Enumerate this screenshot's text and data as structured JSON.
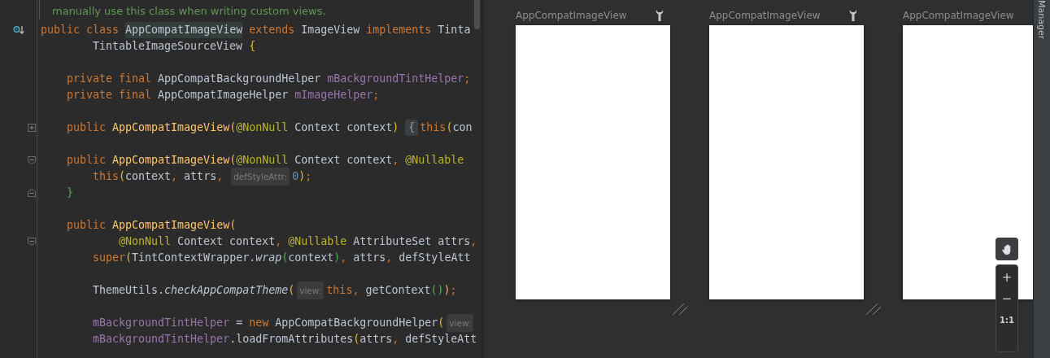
{
  "editor": {
    "doc_comment": "manually use this class when writing custom views.",
    "lines": [
      {
        "kind": "code",
        "marker": {
          "kind": "implemented"
        },
        "words": [
          [
            {
              "kind": "kw",
              "text": "public"
            }
          ],
          [
            {
              "kind": "kw",
              "text": "class"
            }
          ],
          [
            {
              "kind": "hl",
              "text": "AppCompatImageView"
            }
          ],
          [
            {
              "kind": "kw",
              "text": "extends"
            }
          ],
          [
            {
              "kind": "type",
              "text": "ImageView"
            }
          ],
          [
            {
              "kind": "kw",
              "text": "implements"
            }
          ],
          [
            {
              "kind": "type",
              "text": "Tinta"
            }
          ]
        ]
      },
      {
        "kind": "code",
        "indent": {
          "kind": "double"
        },
        "words": [
          [
            {
              "kind": "type",
              "text": "TintableImageSourceView"
            }
          ],
          [
            {
              "kind": "br1",
              "text": "{"
            }
          ]
        ]
      },
      {
        "kind": "blank"
      },
      {
        "kind": "code",
        "indent": {
          "kind": "single"
        },
        "words": [
          [
            {
              "kind": "kw",
              "text": "private"
            }
          ],
          [
            {
              "kind": "kw",
              "text": "final"
            }
          ],
          [
            {
              "kind": "type",
              "text": "AppCompatBackgroundHelper"
            }
          ],
          [
            {
              "kind": "field",
              "text": "mBackgroundTintHelper"
            },
            {
              "kind": "punc",
              "text": ";"
            }
          ]
        ]
      },
      {
        "kind": "code",
        "indent": {
          "kind": "single"
        },
        "words": [
          [
            {
              "kind": "kw",
              "text": "private"
            }
          ],
          [
            {
              "kind": "kw",
              "text": "final"
            }
          ],
          [
            {
              "kind": "type",
              "text": "AppCompatImageHelper"
            }
          ],
          [
            {
              "kind": "field",
              "text": "mImageHelper"
            },
            {
              "kind": "punc",
              "text": ";"
            }
          ]
        ]
      },
      {
        "kind": "blank"
      },
      {
        "kind": "code",
        "fold": {
          "kind": "folded"
        },
        "indent": {
          "kind": "single"
        },
        "words": [
          [
            {
              "kind": "kw",
              "text": "public"
            }
          ],
          [
            {
              "kind": "decl",
              "text": "AppCompatImageView"
            },
            {
              "kind": "br1",
              "text": "("
            },
            {
              "kind": "ann",
              "text": "@NonNull"
            }
          ],
          [
            {
              "kind": "type",
              "text": "Context"
            }
          ],
          [
            {
              "kind": "plain",
              "text": "context"
            },
            {
              "kind": "br1",
              "text": ")"
            }
          ],
          [
            {
              "kind": "fold",
              "text": "{"
            },
            {
              "kind": "kw",
              "text": "this"
            },
            {
              "kind": "br1",
              "text": "("
            },
            {
              "kind": "plain",
              "text": "con"
            }
          ]
        ]
      },
      {
        "kind": "blank"
      },
      {
        "kind": "code",
        "fold": {
          "kind": "start"
        },
        "indent": {
          "kind": "single"
        },
        "words": [
          [
            {
              "kind": "kw",
              "text": "public"
            }
          ],
          [
            {
              "kind": "decl",
              "text": "AppCompatImageView"
            },
            {
              "kind": "br1",
              "text": "("
            },
            {
              "kind": "ann",
              "text": "@NonNull"
            }
          ],
          [
            {
              "kind": "type",
              "text": "Context"
            }
          ],
          [
            {
              "kind": "plain",
              "text": "context"
            },
            {
              "kind": "punc",
              "text": ","
            }
          ],
          [
            {
              "kind": "ann",
              "text": "@Nullable"
            }
          ]
        ]
      },
      {
        "kind": "code",
        "indent": {
          "kind": "double"
        },
        "words": [
          [
            {
              "kind": "kw",
              "text": "this"
            },
            {
              "kind": "br1",
              "text": "("
            },
            {
              "kind": "plain",
              "text": "context"
            },
            {
              "kind": "punc",
              "text": ","
            }
          ],
          [
            {
              "kind": "plain",
              "text": "attrs"
            },
            {
              "kind": "punc",
              "text": ","
            }
          ],
          [
            {
              "kind": "hint",
              "text": "defStyleAttr:"
            },
            {
              "kind": "num",
              "text": "0"
            },
            {
              "kind": "br1",
              "text": ")"
            },
            {
              "kind": "punc",
              "text": ";"
            }
          ]
        ]
      },
      {
        "kind": "code",
        "fold": {
          "kind": "end"
        },
        "indent": {
          "kind": "single"
        },
        "words": [
          [
            {
              "kind": "br2",
              "text": "}"
            }
          ]
        ]
      },
      {
        "kind": "blank"
      },
      {
        "kind": "code",
        "indent": {
          "kind": "single"
        },
        "words": [
          [
            {
              "kind": "kw",
              "text": "public"
            }
          ],
          [
            {
              "kind": "decl",
              "text": "AppCompatImageView"
            },
            {
              "kind": "br1",
              "text": "("
            }
          ]
        ]
      },
      {
        "kind": "code",
        "fold": {
          "kind": "start"
        },
        "indent": {
          "kind": "triple"
        },
        "words": [
          [
            {
              "kind": "ann",
              "text": "@NonNull"
            }
          ],
          [
            {
              "kind": "type",
              "text": "Context"
            }
          ],
          [
            {
              "kind": "plain",
              "text": "context"
            },
            {
              "kind": "punc",
              "text": ","
            }
          ],
          [
            {
              "kind": "ann",
              "text": "@Nullable"
            }
          ],
          [
            {
              "kind": "type",
              "text": "AttributeSet"
            }
          ],
          [
            {
              "kind": "plain",
              "text": "attrs"
            },
            {
              "kind": "punc",
              "text": ","
            }
          ]
        ]
      },
      {
        "kind": "code",
        "indent": {
          "kind": "double"
        },
        "words": [
          [
            {
              "kind": "kw",
              "text": "super"
            },
            {
              "kind": "br1",
              "text": "("
            },
            {
              "kind": "type",
              "text": "TintContextWrapper"
            },
            {
              "kind": "plain",
              "text": "."
            },
            {
              "kind": "ital",
              "text": "wrap"
            },
            {
              "kind": "br2",
              "text": "("
            },
            {
              "kind": "plain",
              "text": "context"
            },
            {
              "kind": "br2",
              "text": ")"
            },
            {
              "kind": "punc",
              "text": ","
            }
          ],
          [
            {
              "kind": "plain",
              "text": "attrs"
            },
            {
              "kind": "punc",
              "text": ","
            }
          ],
          [
            {
              "kind": "plain",
              "text": "defStyleAtt"
            }
          ]
        ]
      },
      {
        "kind": "blank"
      },
      {
        "kind": "code",
        "indent": {
          "kind": "double"
        },
        "words": [
          [
            {
              "kind": "type",
              "text": "ThemeUtils"
            },
            {
              "kind": "plain",
              "text": "."
            },
            {
              "kind": "ital",
              "text": "checkAppCompatTheme"
            },
            {
              "kind": "br1",
              "text": "("
            },
            {
              "kind": "hint",
              "text": "view:"
            },
            {
              "kind": "kw",
              "text": "this"
            },
            {
              "kind": "punc",
              "text": ","
            }
          ],
          [
            {
              "kind": "plain",
              "text": "getContext"
            },
            {
              "kind": "br2",
              "text": "()"
            },
            {
              "kind": "br1",
              "text": ")"
            },
            {
              "kind": "punc",
              "text": ";"
            }
          ]
        ]
      },
      {
        "kind": "blank"
      },
      {
        "kind": "code",
        "indent": {
          "kind": "double"
        },
        "words": [
          [
            {
              "kind": "field",
              "text": "mBackgroundTintHelper"
            }
          ],
          [
            {
              "kind": "plain",
              "text": "="
            }
          ],
          [
            {
              "kind": "kw",
              "text": "new"
            }
          ],
          [
            {
              "kind": "type",
              "text": "AppCompatBackgroundHelper"
            },
            {
              "kind": "br1",
              "text": "("
            },
            {
              "kind": "hint",
              "text": "view:"
            }
          ]
        ]
      },
      {
        "kind": "code",
        "indent": {
          "kind": "double"
        },
        "words": [
          [
            {
              "kind": "field",
              "text": "mBackgroundTintHelper"
            },
            {
              "kind": "plain",
              "text": "."
            },
            {
              "kind": "plain",
              "text": "loadFromAttributes"
            },
            {
              "kind": "br1",
              "text": "("
            },
            {
              "kind": "plain",
              "text": "attrs"
            },
            {
              "kind": "punc",
              "text": ","
            }
          ],
          [
            {
              "kind": "plain",
              "text": "defStyleAtt"
            }
          ]
        ]
      }
    ]
  },
  "design": {
    "devices": [
      {
        "label": "AppCompatImageView",
        "wrench": true,
        "resize_handle": true
      },
      {
        "label": "AppCompatImageView",
        "wrench": true,
        "resize_handle": true
      },
      {
        "label": "AppCompatImageView",
        "wrench": false,
        "resize_handle": false
      }
    ],
    "zoom_controls": [
      "+",
      "−",
      "1:1"
    ]
  },
  "side_tab": {
    "label": "Manager"
  }
}
